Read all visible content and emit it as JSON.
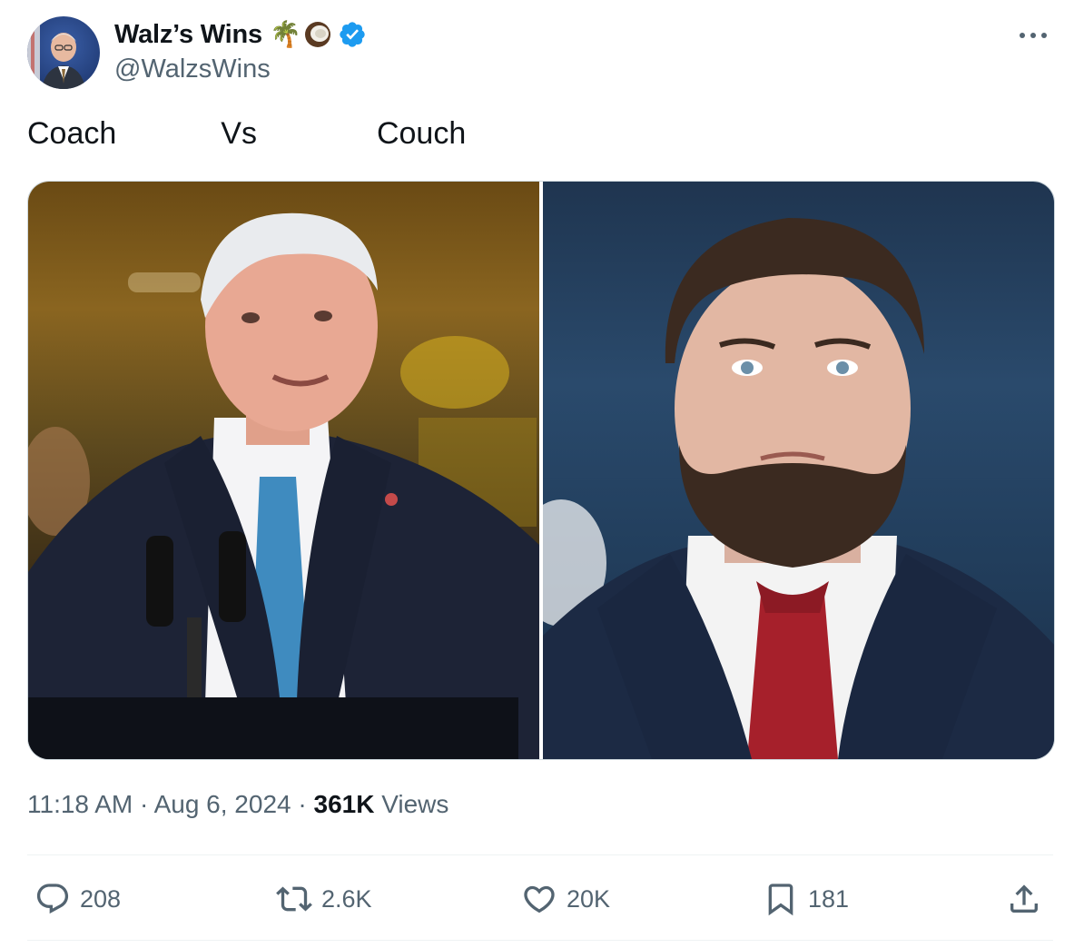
{
  "tweet": {
    "author": {
      "display_name": "Walz’s Wins",
      "handle": "@WalzsWins",
      "emoji_palm": "🌴",
      "badge": "verified-badge-icon"
    },
    "text_coach": "Coach",
    "text_vs": "Vs",
    "text_couch": "Couch",
    "media": [
      {
        "kind": "photo",
        "subject": "photo-left"
      },
      {
        "kind": "photo",
        "subject": "photo-right"
      }
    ],
    "meta": {
      "time": "11:18 AM",
      "sep": "·",
      "date": "Aug 6, 2024",
      "views_count": "361K",
      "views_label": "Views"
    },
    "actions": {
      "replies": "208",
      "reposts": "2.6K",
      "likes": "20K",
      "bookmarks": "181"
    }
  },
  "colors": {
    "verified": "#1d9bf0",
    "text_primary": "#0f1419",
    "text_secondary": "#536471"
  }
}
